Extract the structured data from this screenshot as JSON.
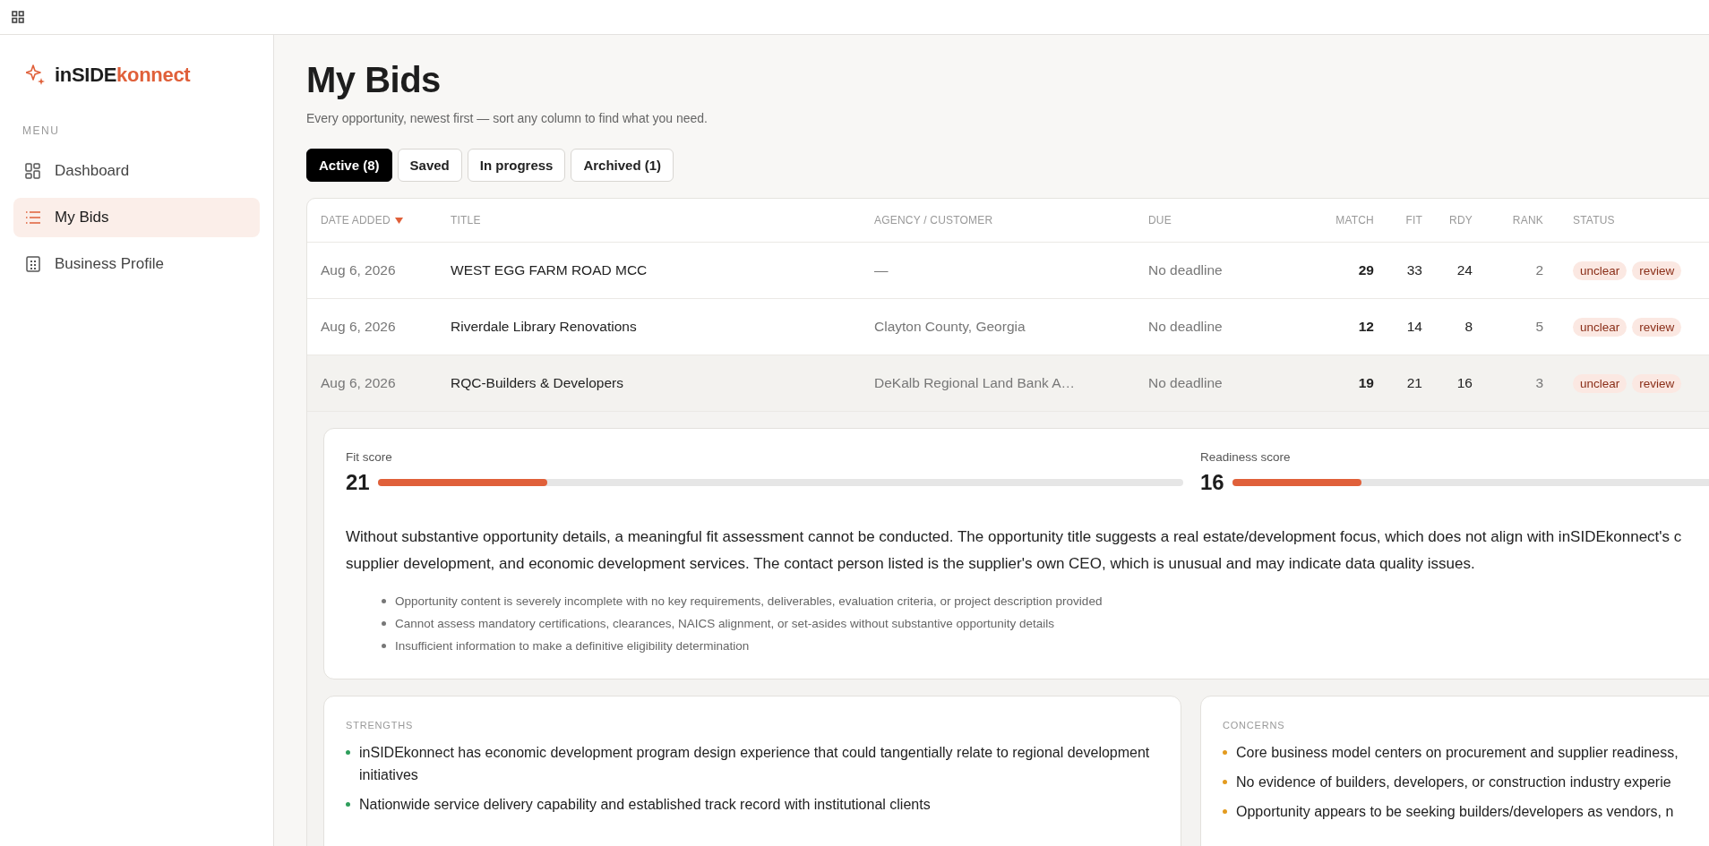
{
  "brand": {
    "name_dark": "inSIDE",
    "name_accent": "konnect"
  },
  "sidebar": {
    "section_label": "MENU",
    "items": [
      {
        "label": "Dashboard",
        "kind": "grid",
        "selected": false
      },
      {
        "label": "My Bids",
        "kind": "list",
        "selected": true
      },
      {
        "label": "Business Profile",
        "kind": "building",
        "selected": false
      }
    ]
  },
  "page": {
    "title": "My Bids",
    "subtitle": "Every opportunity, newest first — sort any column to find what you need."
  },
  "tabs": [
    {
      "label": "Active (8)",
      "selected": true
    },
    {
      "label": "Saved",
      "selected": false
    },
    {
      "label": "In progress",
      "selected": false
    },
    {
      "label": "Archived (1)",
      "selected": false
    }
  ],
  "table": {
    "columns": [
      {
        "label": "DATE ADDED",
        "sorted": true
      },
      {
        "label": "TITLE",
        "sorted": false
      },
      {
        "label": "AGENCY / CUSTOMER",
        "sorted": false
      },
      {
        "label": "DUE",
        "sorted": false
      },
      {
        "label": "MATCH",
        "sorted": false
      },
      {
        "label": "FIT",
        "sorted": false
      },
      {
        "label": "RDY",
        "sorted": false
      },
      {
        "label": "RANK",
        "sorted": false
      },
      {
        "label": "STATUS",
        "sorted": false
      }
    ],
    "rows": [
      {
        "date": "Aug 6, 2026",
        "title": "WEST EGG FARM ROAD MCC",
        "agency": "—",
        "due": "No deadline",
        "match": "29",
        "fit": "33",
        "rdy": "24",
        "rank": "2",
        "statuses": [
          "unclear",
          "review"
        ],
        "expanded": false
      },
      {
        "date": "Aug 6, 2026",
        "title": "Riverdale Library Renovations",
        "agency": "Clayton County, Georgia",
        "due": "No deadline",
        "match": "12",
        "fit": "14",
        "rdy": "8",
        "rank": "5",
        "statuses": [
          "unclear",
          "review"
        ],
        "expanded": false
      },
      {
        "date": "Aug 6, 2026",
        "title": "RQC-Builders & Developers",
        "agency": "DeKalb Regional Land Bank A…",
        "due": "No deadline",
        "match": "19",
        "fit": "21",
        "rdy": "16",
        "rank": "3",
        "statuses": [
          "unclear",
          "review"
        ],
        "expanded": true
      }
    ]
  },
  "detail": {
    "scores": [
      {
        "label": "Fit score",
        "value": "21",
        "level": 0.21
      },
      {
        "label": "Readiness score",
        "value": "16",
        "level": 0.16
      }
    ],
    "summary_lines": [
      "Without substantive opportunity details, a meaningful fit assessment cannot be conducted. The opportunity title suggests a real estate/development focus, which does not align with inSIDEkonnect's c",
      "supplier development, and economic development services. The contact person listed is the supplier's own CEO, which is unusual and may indicate data quality issues."
    ],
    "notes": [
      "Opportunity content is severely incomplete with no key requirements, deliverables, evaluation criteria, or project description provided",
      "Cannot assess mandatory certifications, clearances, NAICS alignment, or set-asides without substantive opportunity details",
      "Insufficient information to make a definitive eligibility determination"
    ]
  },
  "insight_cards": [
    {
      "kind": "strengths",
      "title": "STRENGTHS",
      "items": [
        "inSIDEkonnect has economic development program design experience that could tangentially relate to regional development initiatives",
        "Nationwide service delivery capability and established track record with institutional clients"
      ]
    },
    {
      "kind": "concerns",
      "title": "CONCERNS",
      "items": [
        "Core business model centers on procurement and supplier readiness,",
        "No evidence of builders, developers, or construction industry experie",
        "Opportunity appears to be seeking builders/developers as vendors, n"
      ]
    }
  ]
}
